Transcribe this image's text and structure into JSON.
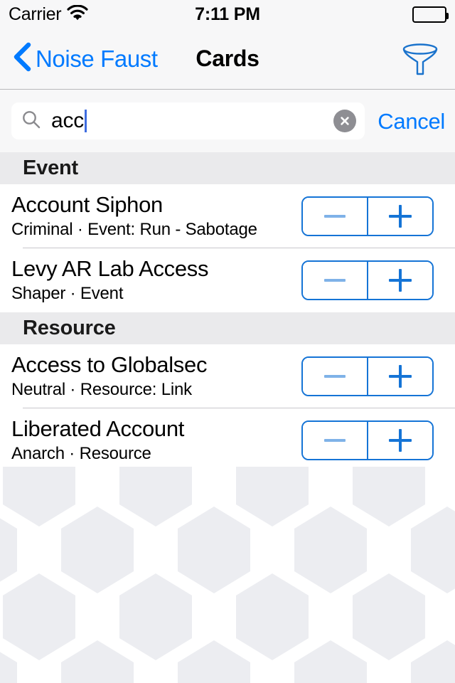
{
  "status_bar": {
    "carrier": "Carrier",
    "wifi_icon": "wifi-icon",
    "time": "7:11 PM",
    "battery_icon": "battery-full-icon"
  },
  "nav_bar": {
    "back_icon": "chevron-left-icon",
    "back_label": "Noise Faust",
    "title": "Cards",
    "filter_icon": "funnel-filter-icon"
  },
  "search": {
    "icon": "search-icon",
    "value": "acc",
    "placeholder": "Search",
    "clear_icon": "clear-circle-icon",
    "cancel_label": "Cancel"
  },
  "colors": {
    "ios_blue": "#007AFF",
    "stepper_blue": "#1574D6",
    "stepper_disabled_blue": "#7FB2E8",
    "nav_background": "#F7F7F8",
    "section_header_background": "#EAEAEC",
    "hex_fill": "#ECEDF1",
    "separator": "#C8C7CC"
  },
  "sections": [
    {
      "header": "Event",
      "rows": [
        {
          "title": "Account Siphon",
          "subtitle": "Criminal · Event: Run - Sabotage",
          "stepper": {
            "minus_label": "−",
            "plus_label": "+",
            "minus_enabled": false,
            "plus_enabled": true
          }
        },
        {
          "title": "Levy AR Lab Access",
          "subtitle": "Shaper · Event",
          "stepper": {
            "minus_label": "−",
            "plus_label": "+",
            "minus_enabled": false,
            "plus_enabled": true
          }
        }
      ]
    },
    {
      "header": "Resource",
      "rows": [
        {
          "title": "Access to Globalsec",
          "subtitle": "Neutral · Resource: Link",
          "stepper": {
            "minus_label": "−",
            "plus_label": "+",
            "minus_enabled": false,
            "plus_enabled": true
          }
        },
        {
          "title": "Liberated Account",
          "subtitle": "Anarch · Resource",
          "stepper": {
            "minus_label": "−",
            "plus_label": "+",
            "minus_enabled": false,
            "plus_enabled": true
          }
        }
      ]
    }
  ],
  "background": {
    "pattern": "hexagon-honeycomb-pattern"
  }
}
